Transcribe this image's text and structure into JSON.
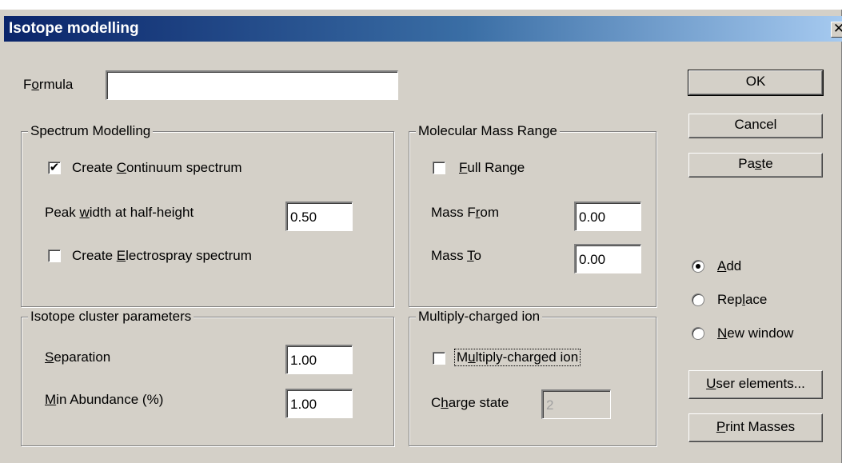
{
  "window": {
    "title": "Isotope modelling",
    "close_glyph": "✕"
  },
  "formula": {
    "label_pre": "F",
    "label_mn": "o",
    "label_post": "rmula",
    "value": ""
  },
  "spectrum": {
    "legend": "Spectrum Modelling",
    "continuum": {
      "pre": "Create ",
      "mn": "C",
      "post": "ontinuum spectrum",
      "checked": true,
      "mark": "✔"
    },
    "peak": {
      "pre": "Peak ",
      "mn": "w",
      "post": "idth at half-height",
      "value": "0.50"
    },
    "electrospray": {
      "pre": "Create ",
      "mn": "E",
      "post": "lectrospray spectrum",
      "checked": false
    }
  },
  "mass_range": {
    "legend": "Molecular Mass Range",
    "full": {
      "pre": "",
      "mn": "F",
      "post": "ull Range",
      "checked": false
    },
    "from": {
      "pre": "Mass F",
      "mn": "r",
      "post": "om",
      "value": "0.00"
    },
    "to": {
      "pre": "Mass ",
      "mn": "T",
      "post": "o",
      "value": "0.00"
    }
  },
  "isotope": {
    "legend": "Isotope cluster parameters",
    "separation": {
      "pre": "",
      "mn": "S",
      "post": "eparation",
      "value": "1.00"
    },
    "min_abundance": {
      "pre": "",
      "mn": "M",
      "post": "in Abundance (%)",
      "value": "1.00"
    }
  },
  "multiply": {
    "legend": "Multiply-charged ion",
    "check": {
      "pre": "M",
      "mn": "u",
      "post": "ltiply-charged ion",
      "checked": false
    },
    "charge": {
      "pre": "C",
      "mn": "h",
      "post": "arge state",
      "value": "2"
    }
  },
  "buttons": {
    "ok": {
      "pre": "",
      "mn": "",
      "post": "OK"
    },
    "cancel": {
      "pre": "",
      "mn": "",
      "post": "Cancel"
    },
    "paste": {
      "pre": "Pa",
      "mn": "s",
      "post": "te"
    },
    "user_elements": {
      "pre": "",
      "mn": "U",
      "post": "ser elements..."
    },
    "print_masses": {
      "pre": "",
      "mn": "P",
      "post": "rint Masses"
    }
  },
  "mode": {
    "selected": "add",
    "add": {
      "pre": "",
      "mn": "A",
      "post": "dd"
    },
    "replace": {
      "pre": "Rep",
      "mn": "l",
      "post": "ace"
    },
    "new_window": {
      "pre": "",
      "mn": "N",
      "post": "ew window"
    }
  }
}
